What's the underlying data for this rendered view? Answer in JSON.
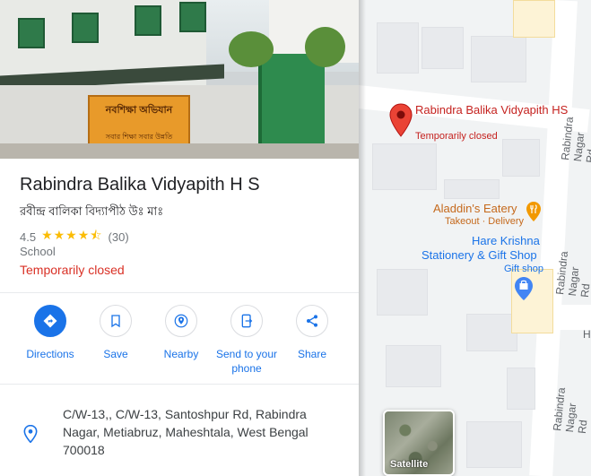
{
  "place": {
    "name": "Rabindra Balika Vidyapith H S",
    "native_name": "রবীন্দ্র বালিকা বিদ্যাপীঠ উঃ মাঃ",
    "rating": "4.5",
    "stars": "★★★★⯪",
    "review_count": "(30)",
    "category": "School",
    "status": "Temporarily closed",
    "photo_sign_text": "নবশিক্ষা অভিযান",
    "photo_sign_subtext": "সবার শিক্ষা সবার উন্নতি"
  },
  "actions": [
    {
      "label": "Directions",
      "icon": "directions-icon"
    },
    {
      "label": "Save",
      "icon": "bookmark-icon"
    },
    {
      "label": "Nearby",
      "icon": "nearby-icon"
    },
    {
      "label": "Send to your phone",
      "icon": "send-to-phone-icon"
    },
    {
      "label": "Share",
      "icon": "share-icon"
    }
  ],
  "address": {
    "line": "C/W-13,, C/W-13, Santoshpur Rd, Rabindra Nagar, Metiabruz, Maheshtala, West Bengal 700018",
    "icon": "location-pin-icon"
  },
  "map": {
    "selected_place_label": "Rabindra Balika Vidyapith HS",
    "selected_place_status": "Temporarily closed",
    "poi_1_name": "Aladdin's Eatery",
    "poi_1_detail": "Takeout · Delivery",
    "poi_2_name_line1": "Hare Krishna",
    "poi_2_name_line2": "Stationery & Gift Shop",
    "poi_2_detail": "Gift shop",
    "road_1": "Rabindra Nagar Rd",
    "road_2": "Rabindra Nagar Rd",
    "road_3": "Rabindra Nagar Rd",
    "layer_button": "Satellite"
  },
  "colors": {
    "accent_blue": "#1a73e8",
    "closed_red": "#d93025",
    "star_yellow": "#fbbc04",
    "eatery_orange": "#c5691c",
    "shop_blue": "#1a73e8",
    "pin_red": "#ea4335"
  }
}
